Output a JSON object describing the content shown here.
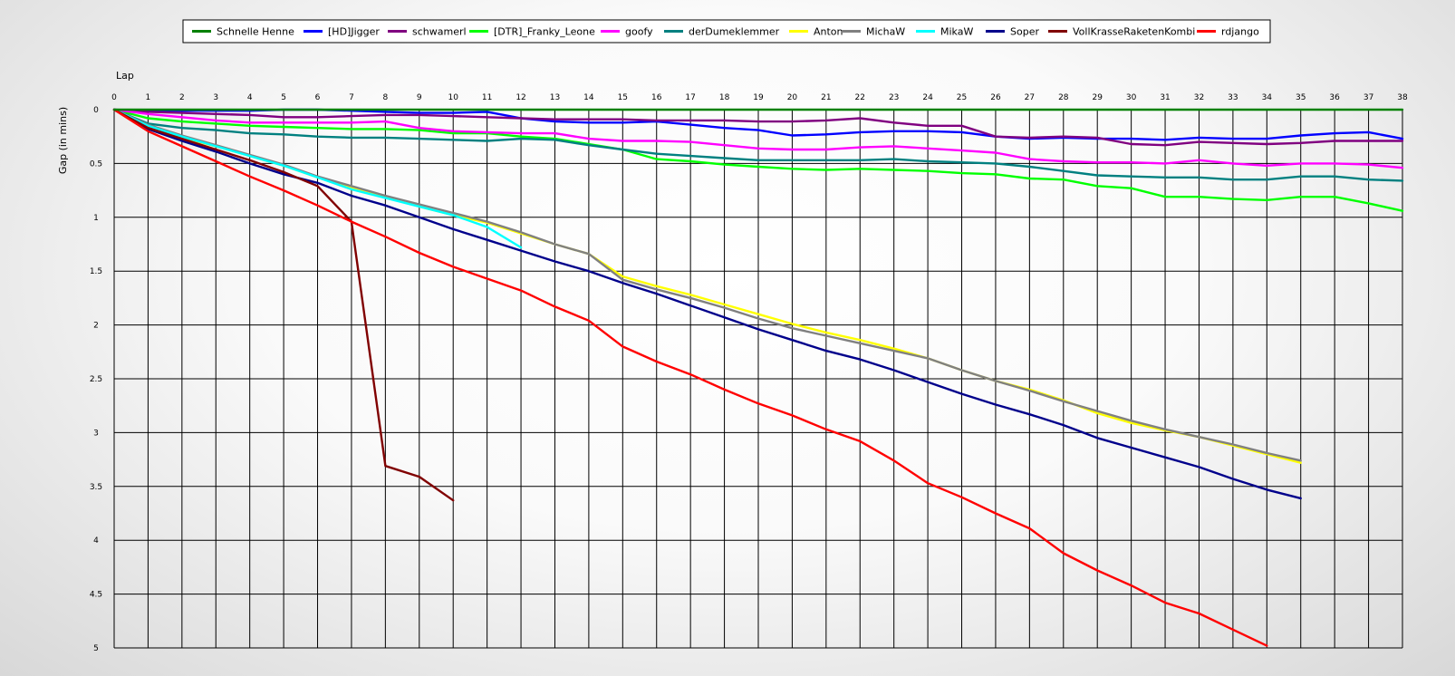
{
  "chart_data": {
    "type": "line",
    "xlabel": "Lap",
    "ylabel": "Gap (in mins)",
    "xlim": [
      0,
      38
    ],
    "ylim": [
      0,
      5
    ],
    "x_ticks": [
      0,
      1,
      2,
      3,
      4,
      5,
      6,
      7,
      8,
      9,
      10,
      11,
      12,
      13,
      14,
      15,
      16,
      17,
      18,
      19,
      20,
      21,
      22,
      23,
      24,
      25,
      26,
      27,
      28,
      29,
      30,
      31,
      32,
      33,
      34,
      35,
      36,
      37,
      38
    ],
    "y_ticks": [
      0,
      0.5,
      1,
      1.5,
      2,
      2.5,
      3,
      3.5,
      4,
      4.5,
      5
    ],
    "y_tick_labels": [
      "0",
      "0.5",
      "1",
      "1.5",
      "2",
      "2.5",
      "3",
      "3.5",
      "4",
      "4.5",
      "5"
    ],
    "y_axis_inverted": true,
    "grid": true,
    "legend_position": "top",
    "series": [
      {
        "name": "Schnelle Henne",
        "color": "#008000",
        "values": [
          0,
          0,
          0,
          0,
          0,
          0,
          0,
          0,
          0,
          0,
          0,
          0,
          0,
          0,
          0,
          0,
          0,
          0,
          0,
          0,
          0,
          0,
          0,
          0,
          0,
          0,
          0,
          0,
          0,
          0,
          0,
          0,
          0,
          0,
          0,
          0,
          0,
          0,
          0
        ]
      },
      {
        "name": "[HD]Jigger",
        "color": "#0000ff",
        "values": [
          0,
          0.01,
          0.01,
          0.01,
          0.01,
          0,
          0,
          0.01,
          0.02,
          0.03,
          0.03,
          0.02,
          0.08,
          0.11,
          0.12,
          0.12,
          0.11,
          0.14,
          0.17,
          0.19,
          0.24,
          0.23,
          0.21,
          0.2,
          0.2,
          0.21,
          0.25,
          0.27,
          0.26,
          0.27,
          0.27,
          0.28,
          0.26,
          0.27,
          0.27,
          0.24,
          0.22,
          0.21,
          0.27
        ]
      },
      {
        "name": "schwamerl",
        "color": "#800080",
        "values": [
          0,
          0.02,
          0.03,
          0.04,
          0.05,
          0.07,
          0.07,
          0.06,
          0.05,
          0.05,
          0.06,
          0.07,
          0.08,
          0.09,
          0.09,
          0.09,
          0.1,
          0.1,
          0.1,
          0.11,
          0.11,
          0.1,
          0.08,
          0.12,
          0.15,
          0.15,
          0.25,
          0.26,
          0.25,
          0.26,
          0.32,
          0.33,
          0.3,
          0.31,
          0.32,
          0.31,
          0.29,
          0.29,
          0.29
        ]
      },
      {
        "name": "[DTR]_Franky_Leone",
        "color": "#00ff00",
        "values": [
          0,
          0.08,
          0.11,
          0.13,
          0.15,
          0.16,
          0.17,
          0.18,
          0.18,
          0.19,
          0.22,
          0.22,
          0.25,
          0.27,
          0.32,
          0.37,
          0.46,
          0.48,
          0.51,
          0.53,
          0.55,
          0.56,
          0.55,
          0.56,
          0.57,
          0.59,
          0.6,
          0.64,
          0.65,
          0.71,
          0.73,
          0.81,
          0.81,
          0.83,
          0.84,
          0.81,
          0.81,
          0.87,
          0.94
        ]
      },
      {
        "name": "goofy",
        "color": "#ff00ff",
        "values": [
          0,
          0.04,
          0.07,
          0.1,
          0.12,
          0.12,
          0.12,
          0.12,
          0.11,
          0.17,
          0.2,
          0.21,
          0.22,
          0.22,
          0.27,
          0.29,
          0.29,
          0.3,
          0.33,
          0.36,
          0.37,
          0.37,
          0.35,
          0.34,
          0.36,
          0.38,
          0.4,
          0.46,
          0.48,
          0.49,
          0.49,
          0.5,
          0.47,
          0.5,
          0.52,
          0.5,
          0.5,
          0.51,
          0.54
        ]
      },
      {
        "name": "derDumeklemmer",
        "color": "#008080",
        "values": [
          0,
          0.13,
          0.17,
          0.19,
          0.22,
          0.23,
          0.25,
          0.26,
          0.26,
          0.27,
          0.28,
          0.29,
          0.27,
          0.28,
          0.33,
          0.37,
          0.41,
          0.43,
          0.45,
          0.47,
          0.47,
          0.47,
          0.47,
          0.46,
          0.48,
          0.49,
          0.5,
          0.53,
          0.57,
          0.61,
          0.62,
          0.63,
          0.63,
          0.65,
          0.65,
          0.62,
          0.62,
          0.65,
          0.66
        ]
      },
      {
        "name": "Anton",
        "color": "#ffff00",
        "values": [
          0,
          0.15,
          0.26,
          0.34,
          0.43,
          0.52,
          0.63,
          0.72,
          0.81,
          0.9,
          0.98,
          1.05,
          1.15,
          1.25,
          1.34,
          1.55,
          1.64,
          1.72,
          1.81,
          1.9,
          1.99,
          2.07,
          2.14,
          2.22,
          2.31,
          2.42,
          2.52,
          2.6,
          2.7,
          2.82,
          2.91,
          2.98,
          3.04,
          3.12,
          3.2,
          3.28
        ]
      },
      {
        "name": "MichaW",
        "color": "#808080",
        "values": [
          0,
          0.14,
          0.24,
          0.33,
          0.42,
          0.51,
          0.62,
          0.71,
          0.8,
          0.88,
          0.96,
          1.04,
          1.14,
          1.25,
          1.34,
          1.58,
          1.67,
          1.75,
          1.84,
          1.94,
          2.03,
          2.1,
          2.17,
          2.24,
          2.31,
          2.42,
          2.52,
          2.61,
          2.71,
          2.8,
          2.89,
          2.97,
          3.04,
          3.11,
          3.19,
          3.26
        ]
      },
      {
        "name": "MikaW",
        "color": "#00ffff",
        "values": [
          0,
          0.15,
          0.25,
          0.34,
          0.43,
          0.52,
          0.63,
          0.74,
          0.82,
          0.9,
          0.98,
          1.09,
          1.28
        ]
      },
      {
        "name": "Soper",
        "color": "#00008b",
        "values": [
          0,
          0.18,
          0.29,
          0.39,
          0.5,
          0.6,
          0.68,
          0.8,
          0.89,
          1,
          1.11,
          1.21,
          1.31,
          1.41,
          1.5,
          1.61,
          1.71,
          1.82,
          1.93,
          2.04,
          2.14,
          2.24,
          2.32,
          2.42,
          2.53,
          2.64,
          2.74,
          2.83,
          2.93,
          3.05,
          3.14,
          3.23,
          3.32,
          3.43,
          3.53,
          3.61
        ]
      },
      {
        "name": "VollKrasseRaketenKombi",
        "color": "#800000",
        "values": [
          0,
          0.17,
          0.27,
          0.37,
          0.47,
          0.58,
          0.71,
          1.04,
          3.31,
          3.41,
          3.63
        ]
      },
      {
        "name": "rdjango",
        "color": "#ff0000",
        "values": [
          0,
          0.2,
          0.34,
          0.48,
          0.62,
          0.75,
          0.89,
          1.04,
          1.18,
          1.33,
          1.46,
          1.57,
          1.68,
          1.83,
          1.96,
          2.2,
          2.34,
          2.46,
          2.6,
          2.73,
          2.84,
          2.97,
          3.08,
          3.26,
          3.47,
          3.6,
          3.75,
          3.89,
          4.12,
          4.28,
          4.42,
          4.58,
          4.68,
          4.83,
          4.98
        ]
      }
    ]
  }
}
